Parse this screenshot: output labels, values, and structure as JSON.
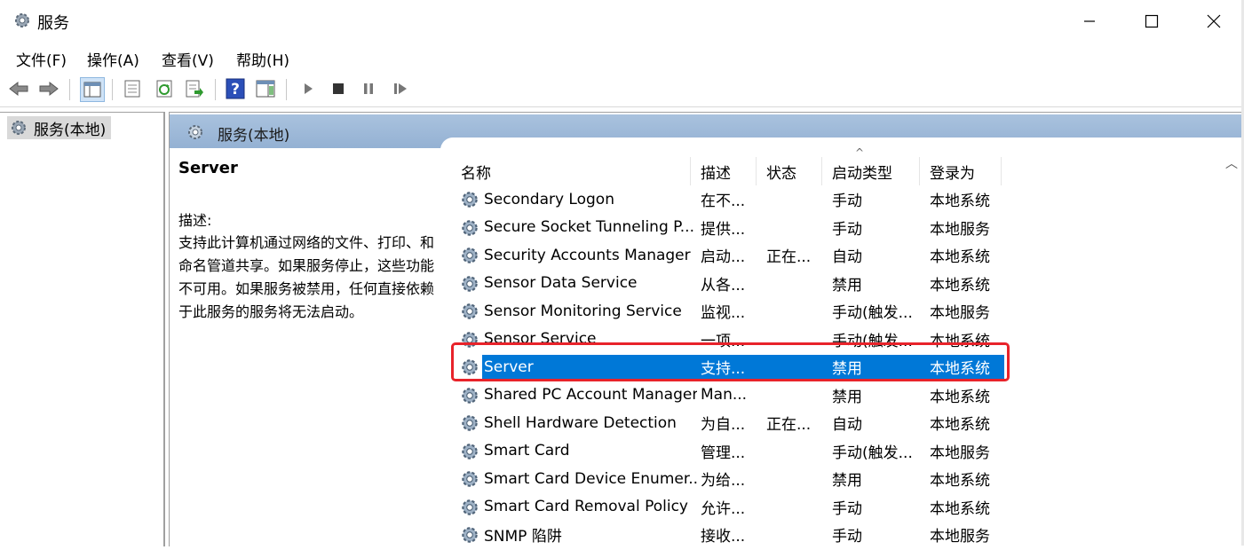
{
  "window": {
    "title": "服务",
    "controls": {
      "minimize": "—",
      "maximize": "☐",
      "close": "✕"
    }
  },
  "menu": [
    "文件(F)",
    "操作(A)",
    "查看(V)",
    "帮助(H)"
  ],
  "toolbar": {
    "buttons": [
      "back-arrow-icon",
      "forward-arrow-icon",
      "show-hide-tree-icon",
      "properties-icon",
      "refresh-icon",
      "export-list-icon",
      "help-icon",
      "show-hide-action-pane-icon",
      "start-service-icon",
      "stop-service-icon",
      "pause-service-icon",
      "resume-service-icon"
    ]
  },
  "tree": {
    "root": "服务(本地)"
  },
  "pane": {
    "header": "服务(本地)"
  },
  "description": {
    "service_name": "Server",
    "label": "描述:",
    "text": "支持此计算机通过网络的文件、打印、和命名管道共享。如果服务停止，这些功能不可用。如果服务被禁用，任何直接依赖于此服务的服务将无法启动。"
  },
  "columns": [
    "名称",
    "描述",
    "状态",
    "启动类型",
    "登录为"
  ],
  "services": [
    {
      "name": "Secondary Logon",
      "desc": "在不...",
      "status": "",
      "startup": "手动",
      "logon": "本地系统"
    },
    {
      "name": "Secure Socket Tunneling P...",
      "desc": "提供...",
      "status": "",
      "startup": "手动",
      "logon": "本地服务"
    },
    {
      "name": "Security Accounts Manager",
      "desc": "启动...",
      "status": "正在...",
      "startup": "自动",
      "logon": "本地系统"
    },
    {
      "name": "Sensor Data Service",
      "desc": "从各...",
      "status": "",
      "startup": "禁用",
      "logon": "本地系统"
    },
    {
      "name": "Sensor Monitoring Service",
      "desc": "监视...",
      "status": "",
      "startup": "手动(触发...",
      "logon": "本地服务"
    },
    {
      "name": "Sensor Service",
      "desc": "一项...",
      "status": "",
      "startup": "手动(触发...",
      "logon": "本地系统"
    },
    {
      "name": "Server",
      "desc": "支持...",
      "status": "",
      "startup": "禁用",
      "logon": "本地系统",
      "selected": true
    },
    {
      "name": "Shared PC Account Manager",
      "desc": "Man...",
      "status": "",
      "startup": "禁用",
      "logon": "本地系统"
    },
    {
      "name": "Shell Hardware Detection",
      "desc": "为自...",
      "status": "正在...",
      "startup": "自动",
      "logon": "本地系统"
    },
    {
      "name": "Smart Card",
      "desc": "管理...",
      "status": "",
      "startup": "手动(触发...",
      "logon": "本地服务"
    },
    {
      "name": "Smart Card Device Enumer...",
      "desc": "为给...",
      "status": "",
      "startup": "禁用",
      "logon": "本地系统"
    },
    {
      "name": "Smart Card Removal Policy",
      "desc": "允许...",
      "status": "",
      "startup": "手动",
      "logon": "本地系统"
    },
    {
      "name": "SNMP 陷阱",
      "desc": "接收...",
      "status": "",
      "startup": "手动",
      "logon": "本地服务"
    }
  ],
  "colors": {
    "selection": "#0078d7",
    "highlight_box": "#e8232a",
    "pane_header": "#a9c2de"
  }
}
